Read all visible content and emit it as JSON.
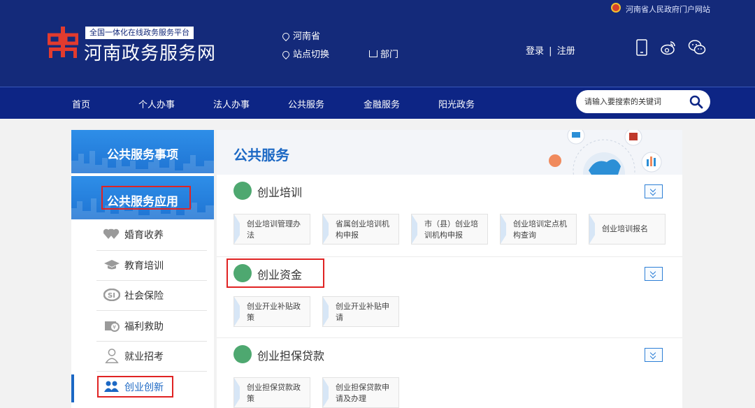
{
  "header": {
    "portal_link": "河南省人民政府门户网站",
    "logo_tagline": "全国一体化在线政务服务平台",
    "logo_name": "河南政务服务网",
    "location": "河南省",
    "switch_site": "站点切换",
    "department": "部门",
    "login": "登录",
    "separator": "|",
    "register": "注册"
  },
  "nav": {
    "items": [
      "首页",
      "个人办事",
      "法人办事",
      "公共服务",
      "金融服务",
      "阳光政务"
    ],
    "search_placeholder": "请输入要搜索的关键词"
  },
  "sidebar": {
    "head1": "公共服务事项",
    "head2": "公共服务应用",
    "items": [
      {
        "label": "婚育收养",
        "icon": "heart-icon"
      },
      {
        "label": "教育培训",
        "icon": "graduation-cap-icon"
      },
      {
        "label": "社会保险",
        "icon": "social-insurance-icon"
      },
      {
        "label": "福利救助",
        "icon": "welfare-icon"
      },
      {
        "label": "就业招考",
        "icon": "person-icon"
      },
      {
        "label": "创业创新",
        "icon": "team-icon"
      }
    ]
  },
  "main": {
    "banner_title": "公共服务",
    "sections": [
      {
        "title": "创业培训",
        "cards": [
          "创业培训管理办法",
          "省属创业培训机构申报",
          "市（县）创业培训机构申报",
          "创业培训定点机构查询",
          "创业培训报名"
        ]
      },
      {
        "title": "创业资金",
        "cards": [
          "创业开业补贴政策",
          "创业开业补贴申请"
        ]
      },
      {
        "title": "创业担保贷款",
        "cards": [
          "创业担保贷款政策",
          "创业担保贷款申请及办理"
        ]
      }
    ]
  },
  "colors": {
    "header_bg": "#142a7a",
    "nav_bg": "#0d2585",
    "accent_blue": "#1c68c4",
    "highlight_red": "#e02323",
    "logo_red": "#e23b2e"
  }
}
